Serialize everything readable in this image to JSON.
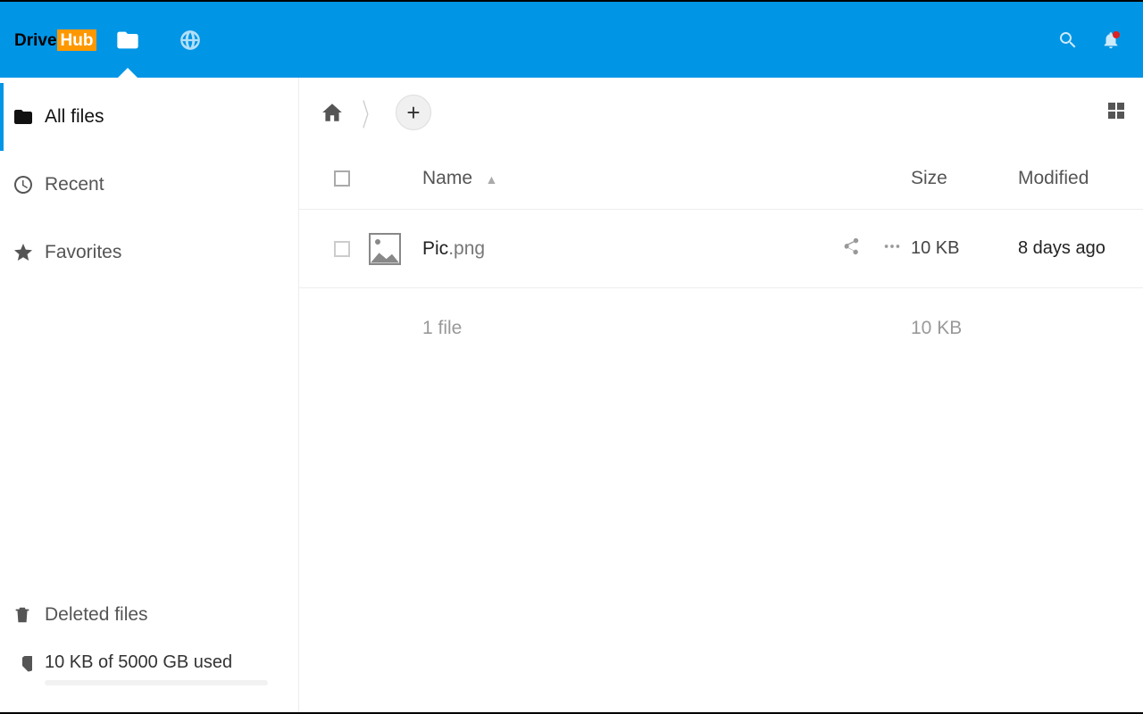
{
  "brand": {
    "left": "Drive",
    "right": "Hub"
  },
  "sidebar": {
    "all_files": "All files",
    "recent": "Recent",
    "favorites": "Favorites",
    "deleted": "Deleted files",
    "quota": "10 KB of 5000 GB used"
  },
  "columns": {
    "name": "Name",
    "size": "Size",
    "modified": "Modified"
  },
  "files": [
    {
      "name": "Pic",
      "ext": ".png",
      "size": "10 KB",
      "modified": "8 days ago"
    }
  ],
  "summary": {
    "count": "1 file",
    "size": "10 KB"
  }
}
